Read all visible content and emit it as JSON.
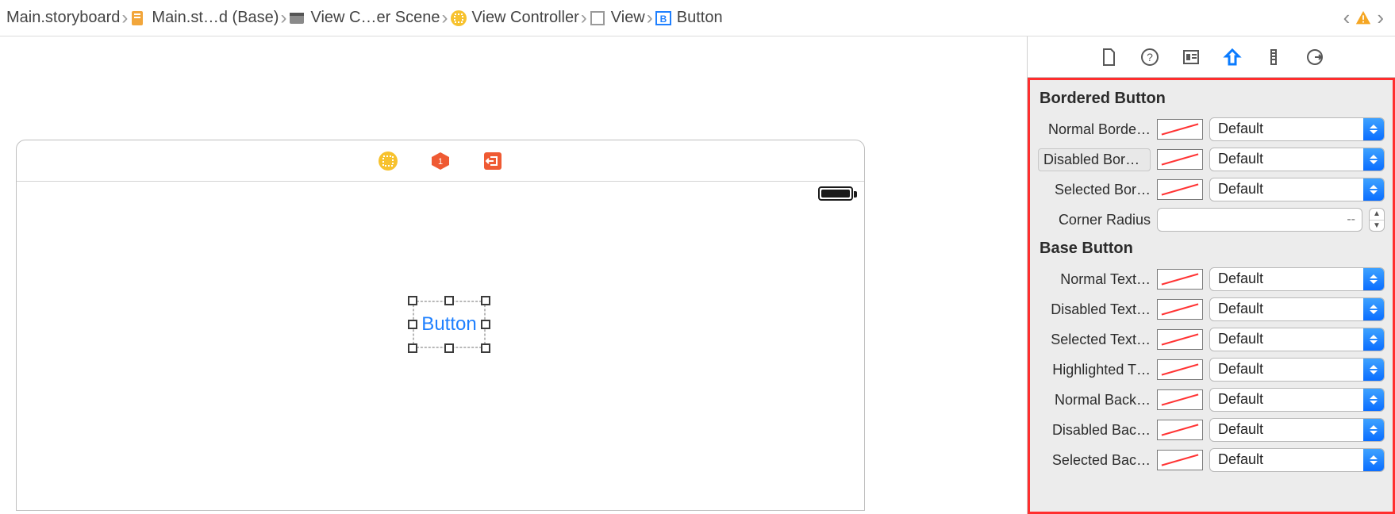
{
  "breadcrumb": [
    {
      "icon": "storyboard",
      "label": "Main.storyboard"
    },
    {
      "icon": "storyboard-file",
      "label": "Main.st…d (Base)"
    },
    {
      "icon": "scene",
      "label": "View C…er Scene"
    },
    {
      "icon": "viewcontroller",
      "label": "View Controller"
    },
    {
      "icon": "view",
      "label": "View"
    },
    {
      "icon": "button",
      "label": "Button"
    }
  ],
  "canvas": {
    "selected_element_label": "Button"
  },
  "inspector": {
    "sections": [
      {
        "title": "Bordered Button",
        "rows": [
          {
            "label": "Normal Borde…",
            "type": "color-combo",
            "value": "Default"
          },
          {
            "label": "Disabled Border Color",
            "type": "color-combo",
            "value": "Default",
            "chip": true
          },
          {
            "label": "Selected Bor…",
            "type": "color-combo",
            "value": "Default"
          },
          {
            "label": "Corner Radius",
            "type": "number",
            "placeholder": "--"
          }
        ]
      },
      {
        "title": "Base Button",
        "rows": [
          {
            "label": "Normal Text…",
            "type": "color-combo",
            "value": "Default"
          },
          {
            "label": "Disabled Text…",
            "type": "color-combo",
            "value": "Default"
          },
          {
            "label": "Selected Text…",
            "type": "color-combo",
            "value": "Default"
          },
          {
            "label": "Highlighted T…",
            "type": "color-combo",
            "value": "Default"
          },
          {
            "label": "Normal Back…",
            "type": "color-combo",
            "value": "Default"
          },
          {
            "label": "Disabled Bac…",
            "type": "color-combo",
            "value": "Default"
          },
          {
            "label": "Selected Bac…",
            "type": "color-combo",
            "value": "Default"
          }
        ]
      }
    ]
  }
}
